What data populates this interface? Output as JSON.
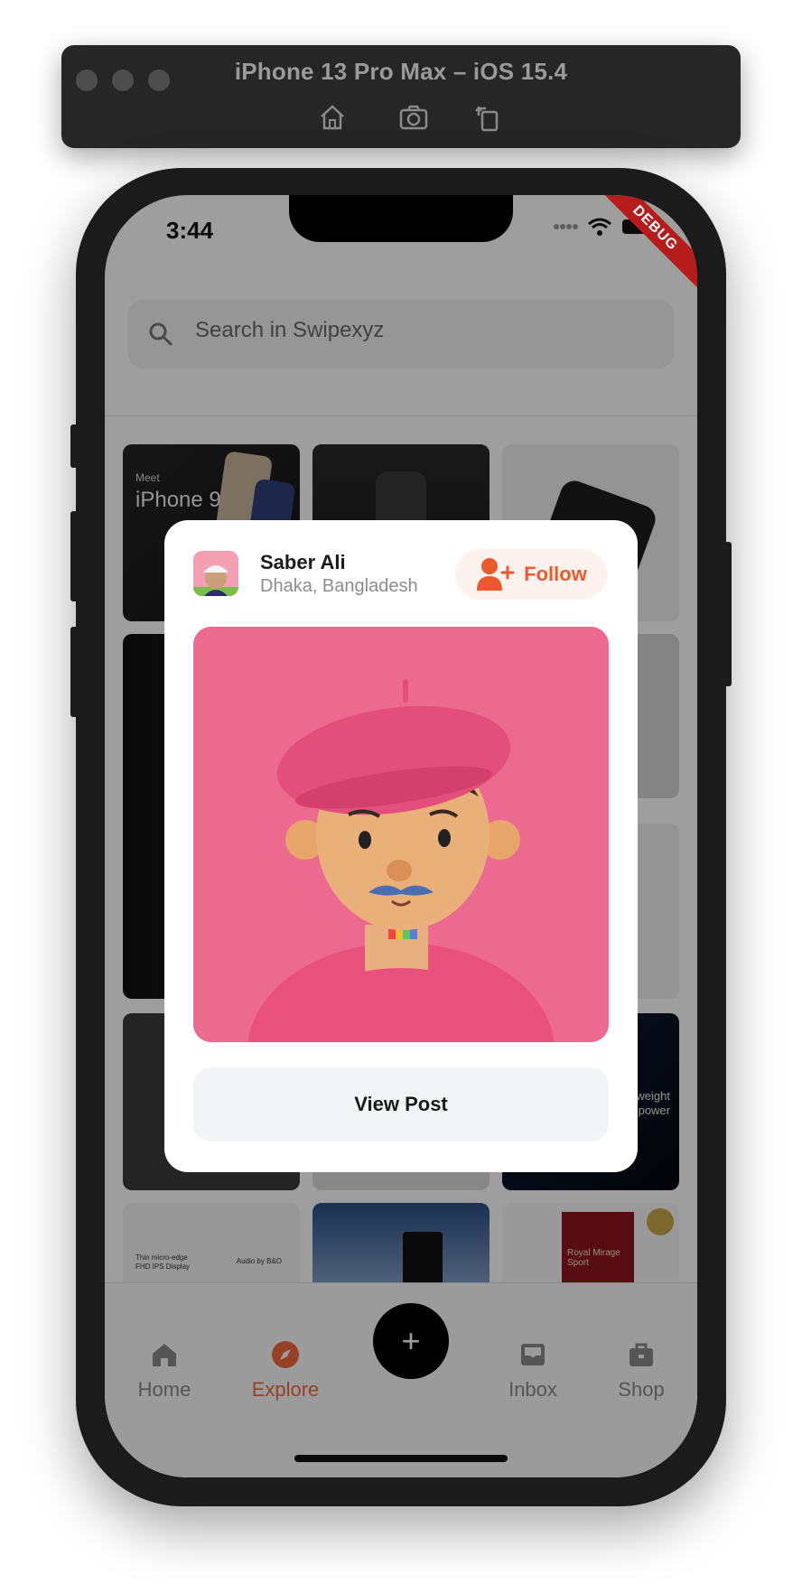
{
  "simulator": {
    "title": "iPhone 13 Pro Max – iOS 15.4",
    "tools": [
      "home-icon",
      "screenshot-icon",
      "rotate-icon"
    ]
  },
  "status_bar": {
    "time": "3:44",
    "debug_label": "DEBUG"
  },
  "search": {
    "placeholder": "Search in Swipexyz"
  },
  "grid_tile_texts": {
    "tile1_small": "Meet",
    "tile1_large": "iPhone 9",
    "tile9_line1": "ttle weight",
    "tile9_line2": "t of power",
    "tile10_left": "Thin micro-edge\nFHD IPS Display",
    "tile10_right": "Audio by B&O",
    "tile12_label": "Royal Mirage\nSport"
  },
  "tabbar": {
    "items": [
      {
        "label": "Home",
        "icon": "home-icon",
        "active": false
      },
      {
        "label": "Explore",
        "icon": "compass-icon",
        "active": true
      },
      {
        "label": "Inbox",
        "icon": "inbox-icon",
        "active": false
      },
      {
        "label": "Shop",
        "icon": "bag-icon",
        "active": false
      }
    ],
    "fab_label": "+"
  },
  "modal": {
    "user_name": "Saber Ali",
    "user_location": "Dhaka, Bangladesh",
    "follow_label": "Follow",
    "view_post_label": "View Post"
  },
  "colors": {
    "accent": "#ea5a2a",
    "post_background": "#ec6a8f",
    "debug_ribbon": "#b71c1c"
  }
}
